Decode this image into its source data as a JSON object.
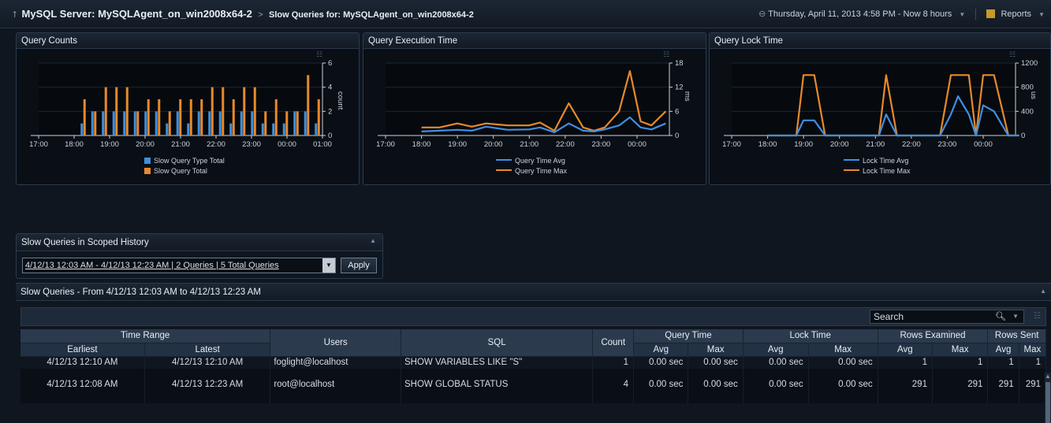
{
  "breadcrumb": {
    "server": "MySQL Server: MySQLAgent_on_win2008x64-2",
    "separator": ">",
    "sub": "Slow Queries for: MySQLAgent_on_win2008x64-2"
  },
  "top_right": {
    "time_range": "Thursday, April 11, 2013 4:58 PM - Now 8 hours",
    "reports": "Reports"
  },
  "panels": {
    "query_counts": {
      "title": "Query Counts",
      "y_axis_label": "count",
      "legend": [
        "Slow Query Type Total",
        "Slow Query Total"
      ]
    },
    "query_execution_time": {
      "title": "Query Execution Time",
      "y_axis_label": "ms",
      "legend": [
        "Query Time Avg",
        "Query Time Max"
      ]
    },
    "query_lock_time": {
      "title": "Query Lock Time",
      "y_axis_label": "us",
      "legend": [
        "Lock Time Avg",
        "Lock Time Max"
      ]
    }
  },
  "chart_data": [
    {
      "type": "bar",
      "title": "Query Counts",
      "xlabel": "",
      "ylabel": "count",
      "x_ticks": [
        "17:00",
        "18:00",
        "19:00",
        "20:00",
        "21:00",
        "22:00",
        "23:00",
        "00:00",
        "01:00"
      ],
      "ylim": [
        0,
        6
      ],
      "y_ticks": [
        0,
        2,
        4,
        6
      ],
      "series": [
        {
          "name": "Slow Query Type Total",
          "color": "#3f8fe0",
          "values": [
            1,
            2,
            2,
            2,
            2,
            2,
            2,
            2,
            1,
            2,
            1,
            2,
            2,
            2,
            1,
            2,
            2,
            1,
            1,
            1,
            2,
            2,
            1
          ]
        },
        {
          "name": "Slow Query Total",
          "color": "#e8892a",
          "values": [
            3,
            2,
            4,
            4,
            4,
            2,
            3,
            3,
            2,
            3,
            3,
            3,
            4,
            4,
            3,
            4,
            4,
            2,
            3,
            2,
            2,
            5,
            3
          ]
        }
      ],
      "x_start": 18.25,
      "x_step": 0.3
    },
    {
      "type": "line",
      "title": "Query Execution Time",
      "xlabel": "",
      "ylabel": "ms",
      "x_ticks": [
        "17:00",
        "18:00",
        "19:00",
        "20:00",
        "21:00",
        "22:00",
        "23:00",
        "00:00"
      ],
      "ylim": [
        0,
        18
      ],
      "y_ticks": [
        0,
        6,
        12,
        18
      ],
      "series": [
        {
          "name": "Query Time Avg",
          "color": "#3f8fe0",
          "x": [
            18.0,
            18.5,
            19.0,
            19.4,
            19.8,
            20.4,
            21.0,
            21.3,
            21.7,
            22.1,
            22.5,
            22.8,
            23.1,
            23.5,
            23.8,
            24.1,
            24.4,
            24.8
          ],
          "y": [
            1.0,
            1.2,
            1.4,
            1.2,
            2.2,
            1.4,
            1.5,
            2.0,
            0.8,
            3.0,
            1.2,
            1.0,
            1.5,
            2.5,
            4.5,
            2.0,
            1.5,
            3.0
          ]
        },
        {
          "name": "Query Time Max",
          "color": "#e8892a",
          "x": [
            18.0,
            18.5,
            19.0,
            19.4,
            19.8,
            20.4,
            21.0,
            21.3,
            21.7,
            22.1,
            22.5,
            22.8,
            23.1,
            23.5,
            23.8,
            24.1,
            24.4,
            24.8
          ],
          "y": [
            2.0,
            2.0,
            3.0,
            2.2,
            3.0,
            2.5,
            2.5,
            3.2,
            1.2,
            8.0,
            2.0,
            1.2,
            2.0,
            6.0,
            16.0,
            3.5,
            2.5,
            6.0
          ]
        }
      ]
    },
    {
      "type": "line",
      "title": "Query Lock Time",
      "xlabel": "",
      "ylabel": "us",
      "x_ticks": [
        "17:00",
        "18:00",
        "19:00",
        "20:00",
        "21:00",
        "22:00",
        "23:00",
        "00:00"
      ],
      "ylim": [
        0,
        1200
      ],
      "y_ticks": [
        0,
        400,
        800,
        1200
      ],
      "series": [
        {
          "name": "Lock Time Avg",
          "color": "#3f8fe0",
          "x": [
            18.0,
            18.5,
            18.8,
            19.0,
            19.3,
            19.6,
            20.5,
            21.1,
            21.3,
            21.6,
            22.8,
            23.1,
            23.3,
            23.6,
            23.8,
            24.0,
            24.3,
            24.7,
            25.0
          ],
          "y": [
            0,
            0,
            0,
            250,
            250,
            0,
            0,
            0,
            350,
            0,
            0,
            350,
            650,
            350,
            0,
            500,
            400,
            0,
            0
          ]
        },
        {
          "name": "Lock Time Max",
          "color": "#e8892a",
          "x": [
            18.0,
            18.5,
            18.8,
            19.0,
            19.3,
            19.6,
            20.5,
            21.1,
            21.3,
            21.6,
            22.8,
            23.1,
            23.3,
            23.6,
            23.8,
            24.0,
            24.3,
            24.7,
            25.0
          ],
          "y": [
            0,
            0,
            0,
            1000,
            1000,
            0,
            0,
            0,
            1000,
            0,
            0,
            1000,
            1000,
            1000,
            0,
            1000,
            1000,
            0,
            0
          ]
        }
      ]
    }
  ],
  "scoped_history": {
    "title": "Slow Queries in Scoped History",
    "selected_range": "4/12/13 12:03 AM - 4/12/13 12:23 AM | 2 Queries | 5 Total Queries",
    "apply_label": "Apply"
  },
  "slow_queries": {
    "title": "Slow Queries - From 4/12/13 12:03 AM to 4/12/13 12:23 AM",
    "search_placeholder": "Search",
    "group_headers": {
      "time_range": "Time Range",
      "users": "Users",
      "sql": "SQL",
      "count": "Count",
      "query_time": "Query Time",
      "lock_time": "Lock Time",
      "rows_examined": "Rows Examined",
      "rows_sent": "Rows Sent"
    },
    "sub_headers": {
      "earliest": "Earliest",
      "latest": "Latest",
      "avg": "Avg",
      "max": "Max"
    },
    "rows": [
      {
        "earliest": "4/12/13 12:10 AM",
        "latest": "4/12/13 12:10 AM",
        "users": "foglight@localhost",
        "sql": "SHOW VARIABLES LIKE \"S\"",
        "count": "1",
        "qt_avg": "0.00 sec",
        "qt_max": "0.00 sec",
        "lt_avg": "0.00 sec",
        "lt_max": "0.00 sec",
        "re_avg": "1",
        "re_max": "1",
        "rs_avg": "1",
        "rs_max": "1"
      },
      {
        "earliest": "4/12/13 12:08 AM",
        "latest": "4/12/13 12:23 AM",
        "users": "root@localhost",
        "sql": "SHOW GLOBAL STATUS",
        "count": "4",
        "qt_avg": "0.00 sec",
        "qt_max": "0.00 sec",
        "lt_avg": "0.00 sec",
        "lt_max": "0.00 sec",
        "re_avg": "291",
        "re_max": "291",
        "rs_avg": "291",
        "rs_max": "291"
      }
    ]
  }
}
